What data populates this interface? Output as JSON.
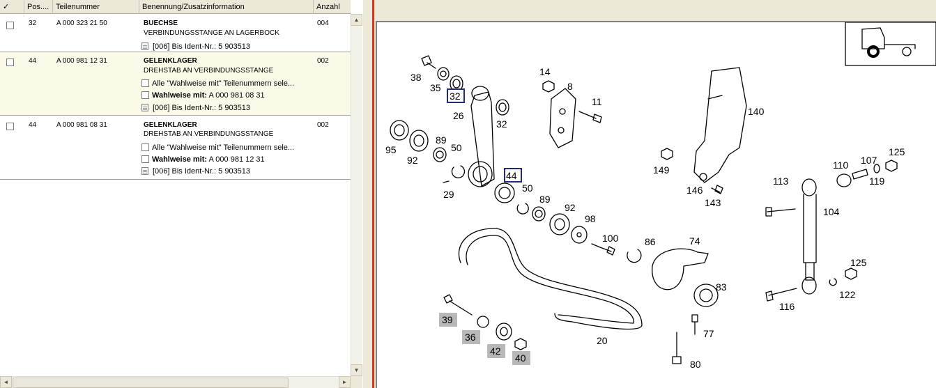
{
  "table": {
    "columns": [
      "✓",
      "Pos....",
      "Teilenummer",
      "Benennung/Zusatzinformation",
      "Anzahl"
    ],
    "rows": [
      {
        "pos": "32",
        "part_no": "A 000 323 21 50",
        "name": "BUECHSE",
        "desc": "VERBINDUNGSSTANGE AN LAGERBOCK",
        "qty": "004",
        "notes": [
          {
            "type": "doc",
            "text": "[006] Bis Ident-Nr.: 5 903513"
          }
        ]
      },
      {
        "pos": "44",
        "part_no": "A 000 981 12 31",
        "name": "GELENKLAGER",
        "desc": "DREHSTAB AN VERBINDUNGSSTANGE",
        "qty": "002",
        "notes": [
          {
            "type": "check",
            "text": "Alle \"Wahlweise mit\" Teilenummern sele..."
          },
          {
            "type": "check",
            "bold": "Wahlweise mit:",
            "text": "A 000 981 08 31"
          },
          {
            "type": "doc",
            "text": "[006] Bis Ident-Nr.: 5 903513"
          }
        ]
      },
      {
        "pos": "44",
        "part_no": "A 000 981 08 31",
        "name": "GELENKLAGER",
        "desc": "DREHSTAB AN VERBINDUNGSSTANGE",
        "qty": "002",
        "notes": [
          {
            "type": "check",
            "text": "Alle \"Wahlweise mit\" Teilenummern sele..."
          },
          {
            "type": "check",
            "bold": "Wahlweise mit:",
            "text": "A 000 981 12 31"
          },
          {
            "type": "doc",
            "text": "[006] Bis Ident-Nr.: 5 903513"
          }
        ]
      }
    ]
  },
  "scroll": {
    "up": "▲",
    "down": "▼",
    "left": "◄",
    "right": "►"
  },
  "diagram": {
    "callouts": [
      "38",
      "35",
      "32",
      "26",
      "14",
      "8",
      "11",
      "140",
      "32",
      "95",
      "92",
      "89",
      "50",
      "149",
      "44",
      "29",
      "50",
      "89",
      "92",
      "98",
      "100",
      "86",
      "74",
      "146",
      "143",
      "113",
      "110",
      "107",
      "125",
      "119",
      "104",
      "83",
      "125",
      "122",
      "116",
      "39",
      "36",
      "42",
      "40",
      "77",
      "80",
      "20"
    ],
    "highlighted_boxed": [
      "32",
      "44"
    ],
    "highlighted_grey": [
      "39",
      "36",
      "42",
      "40"
    ]
  }
}
